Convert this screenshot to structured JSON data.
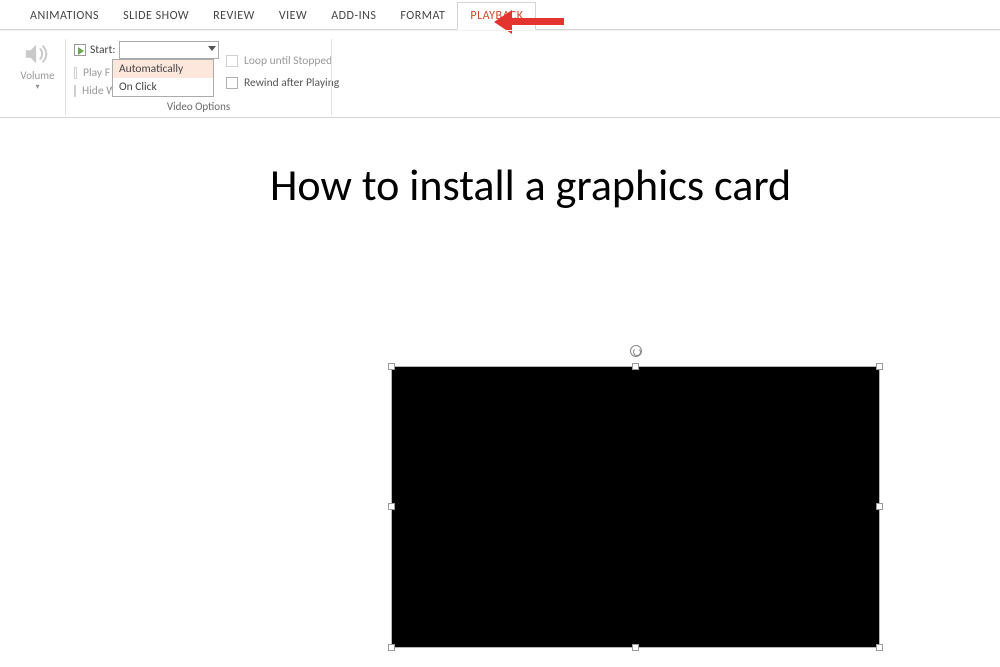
{
  "tabs": {
    "animations": "ANIMATIONS",
    "slideshow": "SLIDE SHOW",
    "review": "REVIEW",
    "view": "VIEW",
    "addins": "ADD-INS",
    "format": "FORMAT",
    "playback": "PLAYBACK"
  },
  "ribbon": {
    "volume_label": "Volume",
    "start_label": "Start:",
    "start_value": "",
    "play_full_label": "Play Full Screen",
    "play_full_trunc": "Play F",
    "hide_label": "Hide While Not Playing",
    "hide_trunc": "Hide W",
    "loop_label": "Loop until Stopped",
    "rewind_label": "Rewind after Playing",
    "group_label": "Video Options",
    "dropdown": {
      "auto": "Automatically",
      "onclick": "On Click"
    }
  },
  "slide": {
    "title": "How to install a graphics card"
  }
}
